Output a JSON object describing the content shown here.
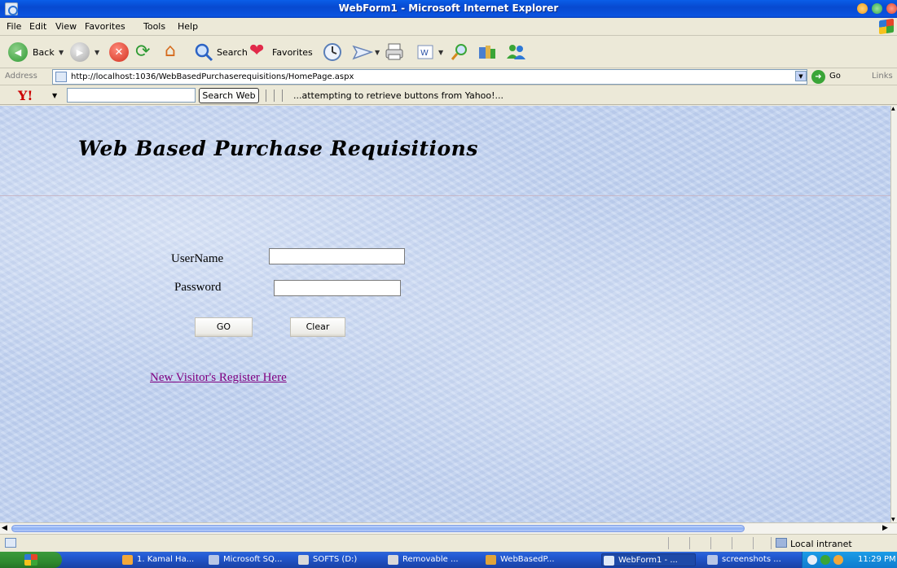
{
  "window": {
    "title": "WebForm1 - Microsoft Internet Explorer"
  },
  "menu": [
    "File",
    "Edit",
    "View",
    "Favorites",
    "Tools",
    "Help"
  ],
  "toolbar": {
    "back": "Back",
    "search": "Search",
    "favorites": "Favorites"
  },
  "address": {
    "label": "Address",
    "url": "http://localhost:1036/WebBasedPurchaserequisitions/HomePage.aspx",
    "go": "Go",
    "links": "Links"
  },
  "yahoo": {
    "logo": "Y!",
    "search_button": "Search Web",
    "status": "...attempting to retrieve buttons from Yahoo!..."
  },
  "page": {
    "heading": "Web Based Purchase Requisitions",
    "username_label": "UserName",
    "password_label": "Password",
    "go_button": "GO",
    "clear_button": "Clear",
    "register_link": "New Visitor's Register Here"
  },
  "status": {
    "zone": "Local intranet"
  },
  "taskbar": {
    "tasks": [
      "1. Kamal Ha...",
      "Microsoft SQ...",
      "SOFTS (D:)",
      "Removable ...",
      "WebBasedP...",
      "WebForm1 - ...",
      "screenshots ..."
    ],
    "clock": "11:29 PM"
  },
  "colors": {
    "title_bar": "#0a53e0",
    "link_visited": "#800080",
    "page_background": "#c2d3f0"
  }
}
